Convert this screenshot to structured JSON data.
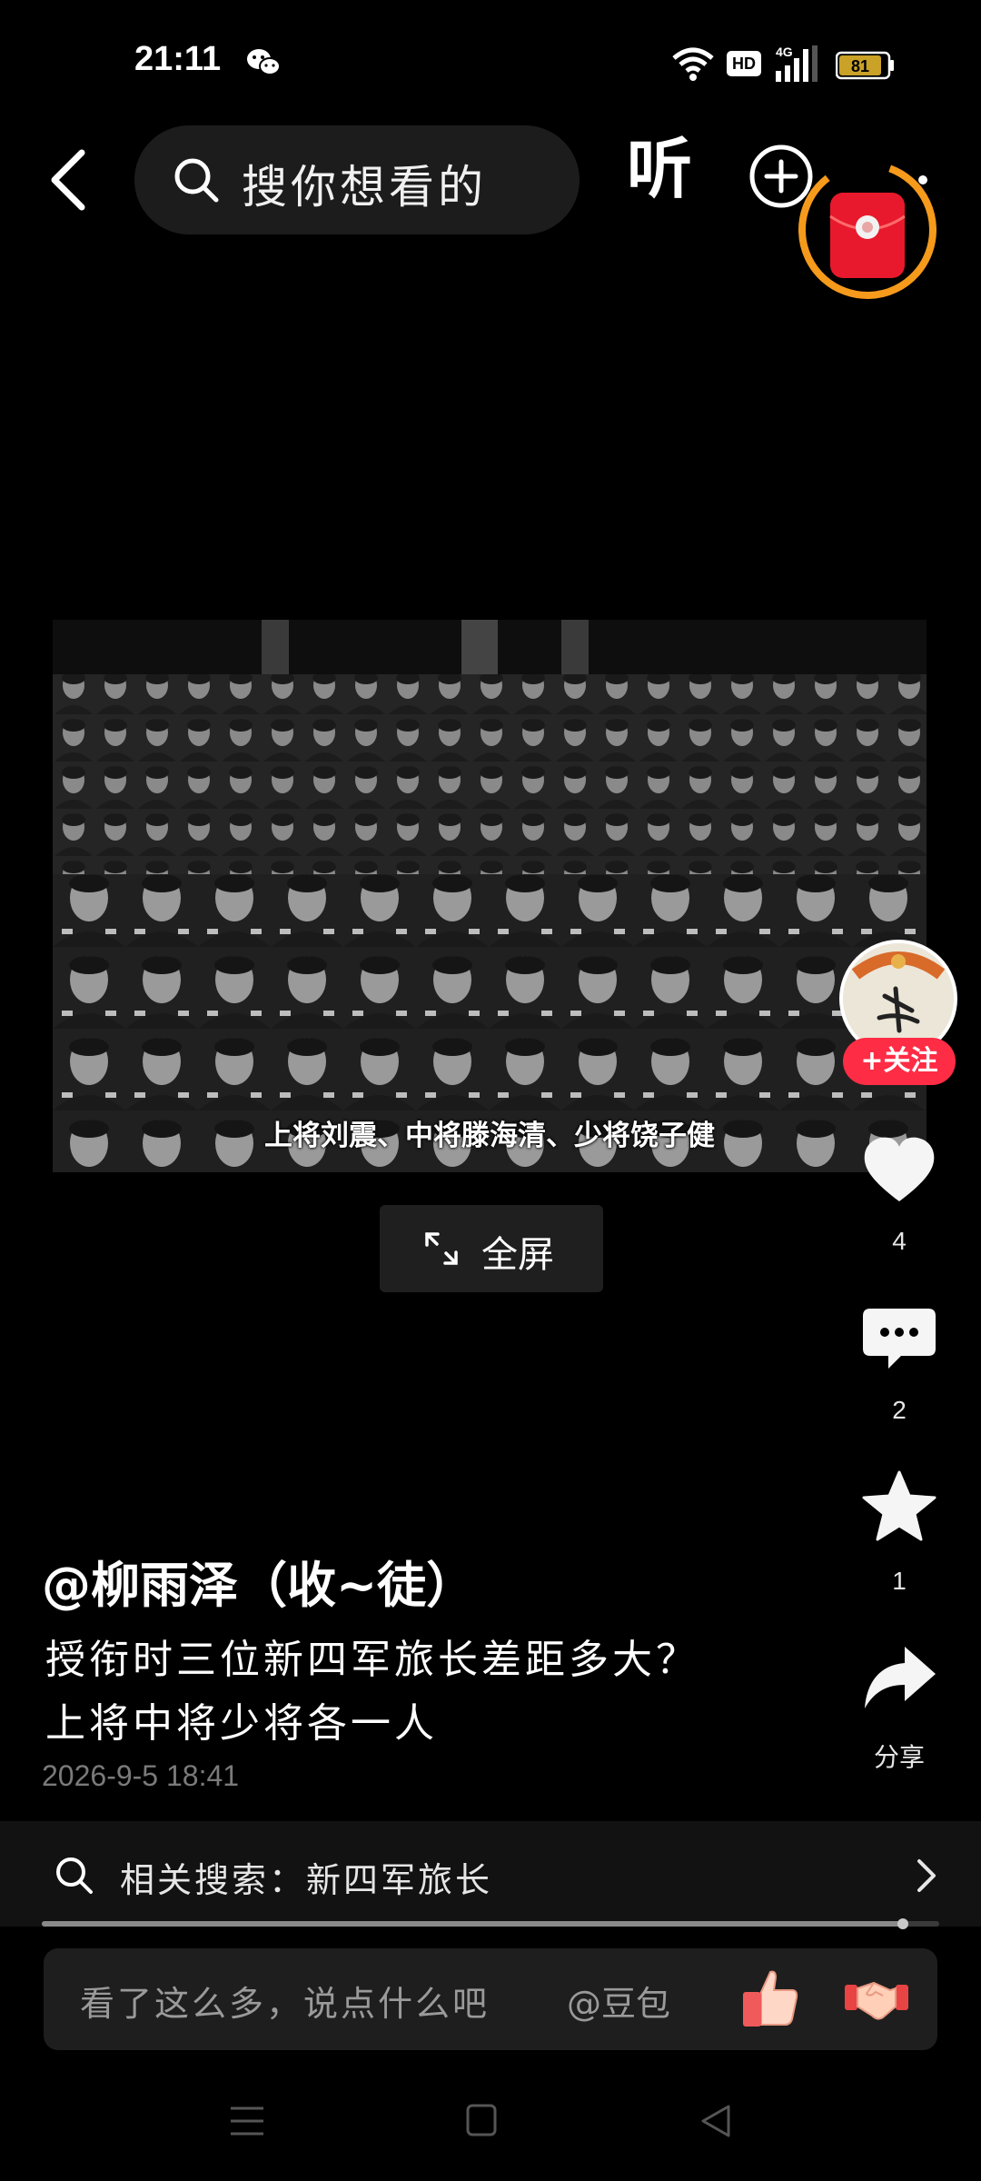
{
  "status_bar": {
    "time": "21:11",
    "network_badge": "HD",
    "network_type": "4G",
    "battery_level": "81"
  },
  "top_bar": {
    "search_placeholder": "搜你想看的",
    "listen_label": "听"
  },
  "video": {
    "caption": "上将刘震、中将滕海清、少将饶子健",
    "fullscreen_label": "全屏"
  },
  "side_actions": {
    "follow_label": "+关注",
    "like_count": "4",
    "comment_count": "2",
    "favorite_count": "1",
    "share_label": "分享"
  },
  "post": {
    "author": "@柳雨泽（收~徒）",
    "description_line1": "授衔时三位新四军旅长差距多大？",
    "description_line2": "上将中将少将各一人",
    "date": "2026-9-5 18:41"
  },
  "related": {
    "label": "相关搜索：新四军旅长"
  },
  "playback": {
    "progress": 0.96
  },
  "comment_bar": {
    "placeholder": "看了这么多，说点什么吧",
    "mention": "@豆包"
  },
  "colors": {
    "background": "#000000",
    "accent_red": "#ff2c45",
    "timer_ring": "#f59a1b"
  },
  "icons": [
    "wechat-icon",
    "wifi-icon",
    "signal-icon",
    "battery-icon",
    "back-icon",
    "search-icon",
    "plus-icon",
    "red-packet-icon",
    "fullscreen-icon",
    "heart-icon",
    "comment-icon",
    "star-icon",
    "share-icon",
    "chevron-right-icon",
    "thumbs-up-icon",
    "handshake-icon",
    "menu-icon",
    "home-icon",
    "back-triangle-icon"
  ]
}
